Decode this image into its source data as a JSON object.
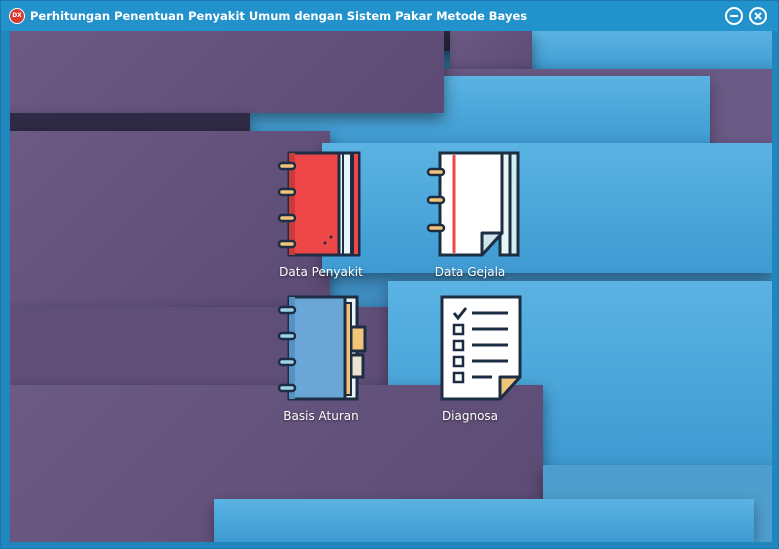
{
  "window": {
    "title": "Perhitungan Penentuan Penyakit Umum dengan Sistem Pakar Metode Bayes",
    "app_icon_text": "DX"
  },
  "menu": [
    {
      "id": "data-penyakit",
      "label": "Data Penyakit",
      "icon": "red-notebook-icon"
    },
    {
      "id": "data-gejala",
      "label": "Data Gejala",
      "icon": "white-notebook-icon"
    },
    {
      "id": "basis-aturan",
      "label": "Basis Aturan",
      "icon": "blue-binder-icon"
    },
    {
      "id": "diagnosa",
      "label": "Diagnosa",
      "icon": "checklist-document-icon"
    }
  ],
  "colors": {
    "titlebar": "#2192cc",
    "purple_block": "#6b5a84",
    "blue_block": "#4fabdd",
    "red_notebook": "#ef4747",
    "binder_blue": "#6aa7d6",
    "outline": "#1d2d44",
    "ring": "#f0c47a"
  }
}
